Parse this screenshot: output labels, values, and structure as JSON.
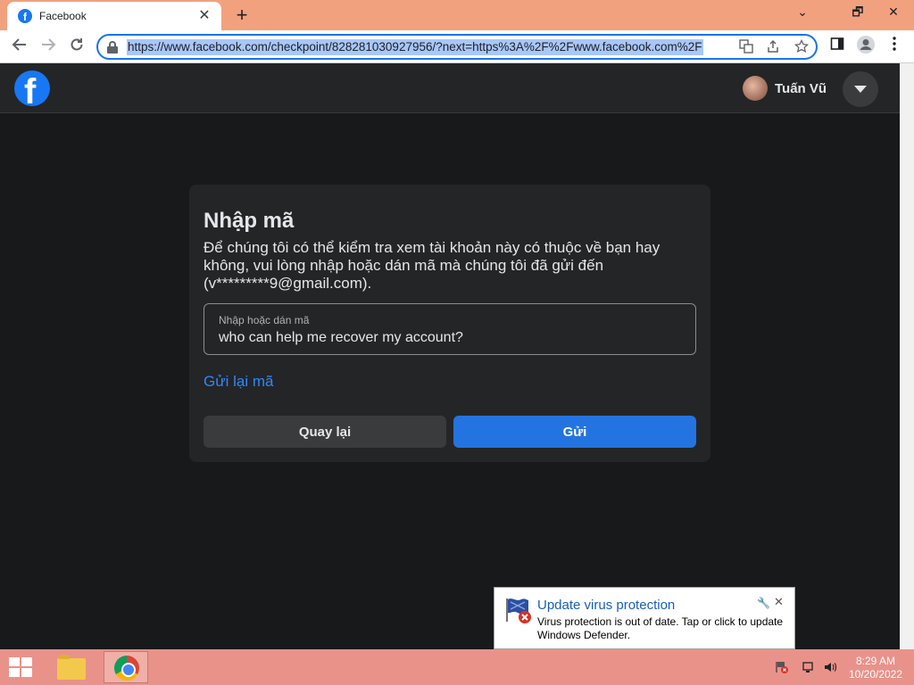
{
  "browser": {
    "tab_title": "Facebook",
    "tab_favicon": "facebook-favicon",
    "url": "https://www.facebook.com/checkpoint/828281030927956/?next=https%3A%2F%2Fwww.facebook.com%2F",
    "window_controls": {
      "minimize": "⌄",
      "restore": "🗗",
      "close": "✕"
    }
  },
  "header": {
    "logo_letter": "f",
    "user_name": "Tuấn Vũ"
  },
  "card": {
    "title": "Nhập mã",
    "description": "Để chúng tôi có thể kiểm tra xem tài khoản này có thuộc về bạn hay không, vui lòng nhập hoặc dán mã mà chúng tôi đã gửi đến (v*********9@gmail.com).",
    "code_label": "Nhập hoặc dán mã",
    "code_value": "who can help me recover my account?",
    "resend_link": "Gửi lại mã",
    "back_button": "Quay lại",
    "send_button": "Gửi"
  },
  "notification": {
    "title": "Update virus protection",
    "body": "Virus protection is out of date. Tap or click to update Windows Defender."
  },
  "taskbar": {
    "time": "8:29 AM",
    "date": "10/20/2022"
  },
  "colors": {
    "facebook_blue": "#1877f2",
    "send_button": "#2374e1",
    "link": "#2d88ff",
    "card_bg": "#242526",
    "page_bg": "#18191a",
    "titlebar": "#f2a17f",
    "taskbar": "#e9928a"
  }
}
